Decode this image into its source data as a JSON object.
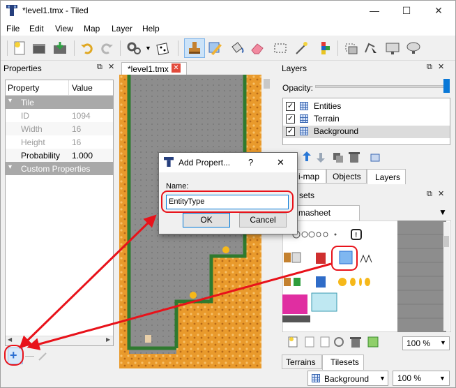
{
  "window": {
    "title": "*level1.tmx - Tiled",
    "minimize_glyph": "—",
    "maximize_glyph": "☐",
    "close_glyph": "✕"
  },
  "menu": [
    "File",
    "Edit",
    "View",
    "Map",
    "Layer",
    "Help"
  ],
  "toolbar": {
    "icons": [
      "new-file-icon",
      "open-folder-icon",
      "save-icon",
      "undo-icon",
      "redo-icon",
      "commands-gear-icon",
      "random-dice-icon",
      "stamp-brush-icon",
      "terrain-brush-icon",
      "bucket-fill-icon",
      "eraser-icon",
      "rect-select-icon",
      "magic-wand-icon",
      "select-same-tile-icon",
      "object-select-icon",
      "edit-polygon-icon",
      "insert-rect-icon",
      "insert-ellipse-icon"
    ]
  },
  "properties": {
    "panel_title": "Properties",
    "col_property": "Property",
    "col_value": "Value",
    "section_tile": "Tile",
    "rows": [
      {
        "name": "ID",
        "value": "1094"
      },
      {
        "name": "Width",
        "value": "16"
      },
      {
        "name": "Height",
        "value": "16"
      },
      {
        "name": "Probability",
        "value": "1.000"
      }
    ],
    "section_custom": "Custom Properties",
    "add_label": "+",
    "remove_label": "—"
  },
  "map_tab": {
    "label": "*level1.tmx"
  },
  "layers": {
    "panel_title": "Layers",
    "opacity_label": "Opacity:",
    "items": [
      {
        "name": "Entities",
        "checked": true,
        "selected": false
      },
      {
        "name": "Terrain",
        "checked": true,
        "selected": false
      },
      {
        "name": "Background",
        "checked": true,
        "selected": true
      }
    ],
    "tabs": [
      "i-map",
      "Objects",
      "Layers"
    ]
  },
  "tilesets": {
    "panel_title": "sets",
    "tab_label": "masheet",
    "zoom": "100 %",
    "bottom_tabs": [
      "Terrains",
      "Tilesets"
    ]
  },
  "status": {
    "layer": "Background",
    "zoom": "100 %"
  },
  "dialog": {
    "title": "Add Propert...",
    "help": "?",
    "close": "✕",
    "name_label": "Name:",
    "name_value": "EntityType",
    "ok_label": "OK",
    "cancel_label": "Cancel"
  },
  "colors": {
    "annotation_red": "#e8121a",
    "selection_blue": "#3a67b2",
    "terrain_orange": "#e99a2c",
    "wall_green": "#2f7a2f"
  }
}
